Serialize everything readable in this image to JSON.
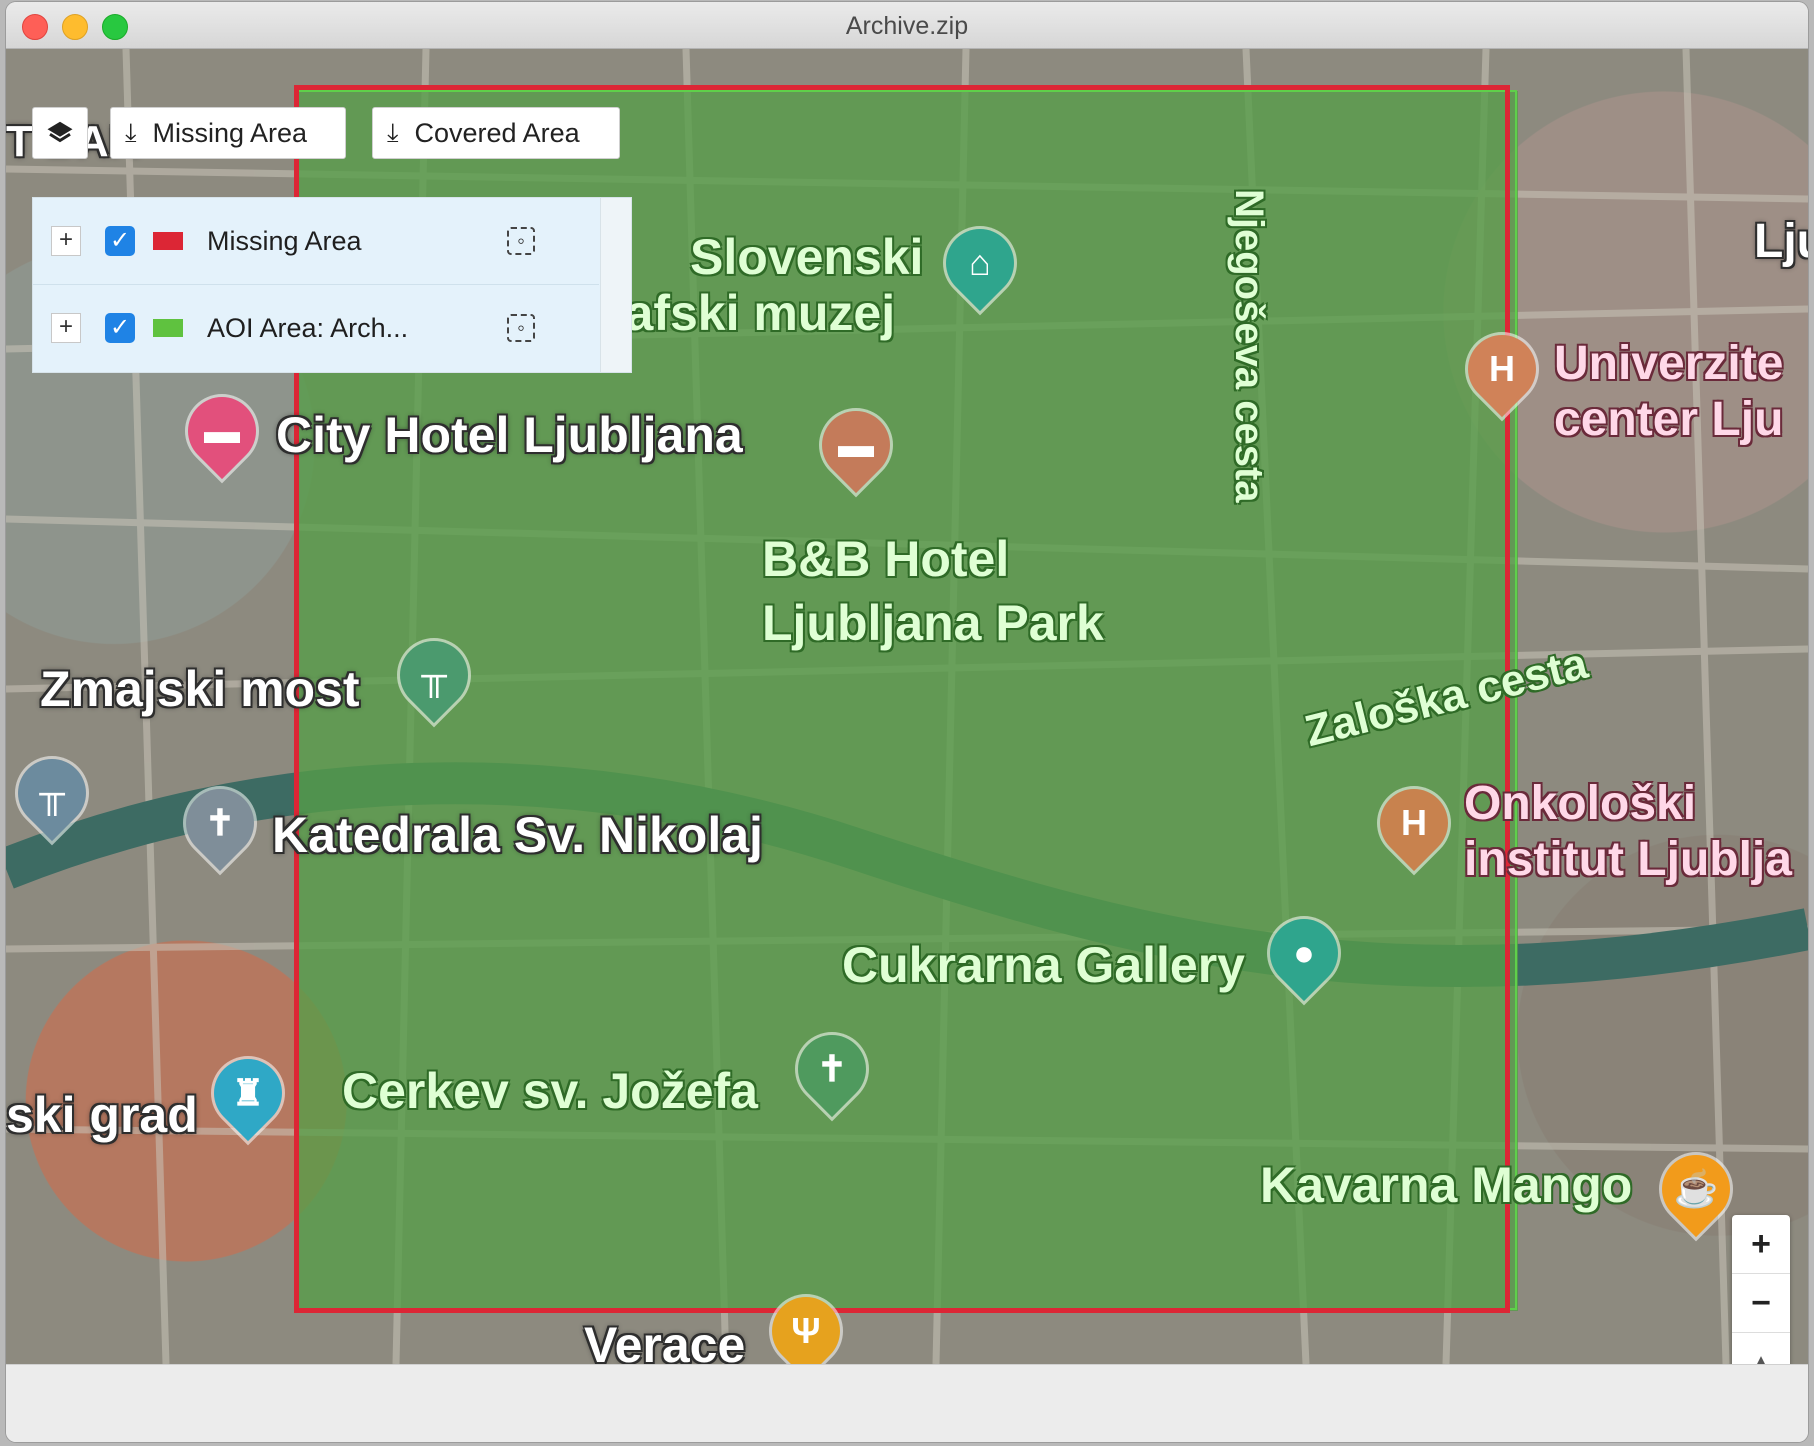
{
  "window": {
    "title": "Archive.zip"
  },
  "toolbar": {
    "layers_icon": "layers-icon",
    "missing_button": "Missing Area",
    "covered_button": "Covered Area",
    "download_icon": "download-icon"
  },
  "layers": [
    {
      "name": "Missing Area",
      "color": "#dc2635",
      "checked": true
    },
    {
      "name": "AOI Area: Arch...",
      "color": "#5fc23f",
      "checked": true
    }
  ],
  "map_labels": {
    "slovenski": "Slovenski",
    "etnografski": "etnografski muzej",
    "city_hotel": "City Hotel Ljubljana",
    "bb_hotel_1": "B&B Hotel",
    "bb_hotel_2": "Ljubljana Park",
    "zmajski": "Zmajski most",
    "katedrala": "Katedrala Sv. Nikolaj",
    "cukrarna": "Cukrarna Gallery",
    "cerkev": "Cerkev sv. Jožefa",
    "grad": "ski grad",
    "kavarna": "Kavarna Mango",
    "verace": "Verace",
    "njegoseva": "Njegoševa cesta",
    "zaloska": "Zaloška cesta",
    "univerz_1": "Univerzite",
    "univerz_2": "center Lju",
    "onkoloski_1": "Onkološki",
    "onkoloski_2": "institut Ljublja",
    "lju": "Lju",
    "tbar": "T BAR"
  },
  "zoom": {
    "in": "+",
    "out": "−",
    "north": "▲"
  },
  "colors": {
    "missing": "#dc2635",
    "aoi": "#5fd04a"
  }
}
